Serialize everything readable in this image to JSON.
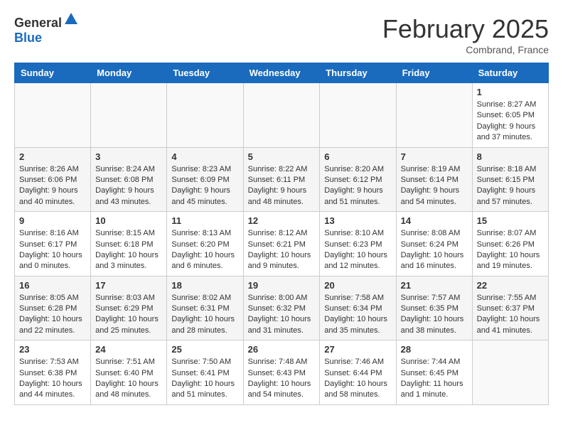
{
  "header": {
    "logo_general": "General",
    "logo_blue": "Blue",
    "month": "February 2025",
    "location": "Combrand, France"
  },
  "days_of_week": [
    "Sunday",
    "Monday",
    "Tuesday",
    "Wednesday",
    "Thursday",
    "Friday",
    "Saturday"
  ],
  "weeks": [
    [
      {
        "day": "",
        "info": ""
      },
      {
        "day": "",
        "info": ""
      },
      {
        "day": "",
        "info": ""
      },
      {
        "day": "",
        "info": ""
      },
      {
        "day": "",
        "info": ""
      },
      {
        "day": "",
        "info": ""
      },
      {
        "day": "1",
        "info": "Sunrise: 8:27 AM\nSunset: 6:05 PM\nDaylight: 9 hours and 37 minutes."
      }
    ],
    [
      {
        "day": "2",
        "info": "Sunrise: 8:26 AM\nSunset: 6:06 PM\nDaylight: 9 hours and 40 minutes."
      },
      {
        "day": "3",
        "info": "Sunrise: 8:24 AM\nSunset: 6:08 PM\nDaylight: 9 hours and 43 minutes."
      },
      {
        "day": "4",
        "info": "Sunrise: 8:23 AM\nSunset: 6:09 PM\nDaylight: 9 hours and 45 minutes."
      },
      {
        "day": "5",
        "info": "Sunrise: 8:22 AM\nSunset: 6:11 PM\nDaylight: 9 hours and 48 minutes."
      },
      {
        "day": "6",
        "info": "Sunrise: 8:20 AM\nSunset: 6:12 PM\nDaylight: 9 hours and 51 minutes."
      },
      {
        "day": "7",
        "info": "Sunrise: 8:19 AM\nSunset: 6:14 PM\nDaylight: 9 hours and 54 minutes."
      },
      {
        "day": "8",
        "info": "Sunrise: 8:18 AM\nSunset: 6:15 PM\nDaylight: 9 hours and 57 minutes."
      }
    ],
    [
      {
        "day": "9",
        "info": "Sunrise: 8:16 AM\nSunset: 6:17 PM\nDaylight: 10 hours and 0 minutes."
      },
      {
        "day": "10",
        "info": "Sunrise: 8:15 AM\nSunset: 6:18 PM\nDaylight: 10 hours and 3 minutes."
      },
      {
        "day": "11",
        "info": "Sunrise: 8:13 AM\nSunset: 6:20 PM\nDaylight: 10 hours and 6 minutes."
      },
      {
        "day": "12",
        "info": "Sunrise: 8:12 AM\nSunset: 6:21 PM\nDaylight: 10 hours and 9 minutes."
      },
      {
        "day": "13",
        "info": "Sunrise: 8:10 AM\nSunset: 6:23 PM\nDaylight: 10 hours and 12 minutes."
      },
      {
        "day": "14",
        "info": "Sunrise: 8:08 AM\nSunset: 6:24 PM\nDaylight: 10 hours and 16 minutes."
      },
      {
        "day": "15",
        "info": "Sunrise: 8:07 AM\nSunset: 6:26 PM\nDaylight: 10 hours and 19 minutes."
      }
    ],
    [
      {
        "day": "16",
        "info": "Sunrise: 8:05 AM\nSunset: 6:28 PM\nDaylight: 10 hours and 22 minutes."
      },
      {
        "day": "17",
        "info": "Sunrise: 8:03 AM\nSunset: 6:29 PM\nDaylight: 10 hours and 25 minutes."
      },
      {
        "day": "18",
        "info": "Sunrise: 8:02 AM\nSunset: 6:31 PM\nDaylight: 10 hours and 28 minutes."
      },
      {
        "day": "19",
        "info": "Sunrise: 8:00 AM\nSunset: 6:32 PM\nDaylight: 10 hours and 31 minutes."
      },
      {
        "day": "20",
        "info": "Sunrise: 7:58 AM\nSunset: 6:34 PM\nDaylight: 10 hours and 35 minutes."
      },
      {
        "day": "21",
        "info": "Sunrise: 7:57 AM\nSunset: 6:35 PM\nDaylight: 10 hours and 38 minutes."
      },
      {
        "day": "22",
        "info": "Sunrise: 7:55 AM\nSunset: 6:37 PM\nDaylight: 10 hours and 41 minutes."
      }
    ],
    [
      {
        "day": "23",
        "info": "Sunrise: 7:53 AM\nSunset: 6:38 PM\nDaylight: 10 hours and 44 minutes."
      },
      {
        "day": "24",
        "info": "Sunrise: 7:51 AM\nSunset: 6:40 PM\nDaylight: 10 hours and 48 minutes."
      },
      {
        "day": "25",
        "info": "Sunrise: 7:50 AM\nSunset: 6:41 PM\nDaylight: 10 hours and 51 minutes."
      },
      {
        "day": "26",
        "info": "Sunrise: 7:48 AM\nSunset: 6:43 PM\nDaylight: 10 hours and 54 minutes."
      },
      {
        "day": "27",
        "info": "Sunrise: 7:46 AM\nSunset: 6:44 PM\nDaylight: 10 hours and 58 minutes."
      },
      {
        "day": "28",
        "info": "Sunrise: 7:44 AM\nSunset: 6:45 PM\nDaylight: 11 hours and 1 minute."
      },
      {
        "day": "",
        "info": ""
      }
    ]
  ]
}
